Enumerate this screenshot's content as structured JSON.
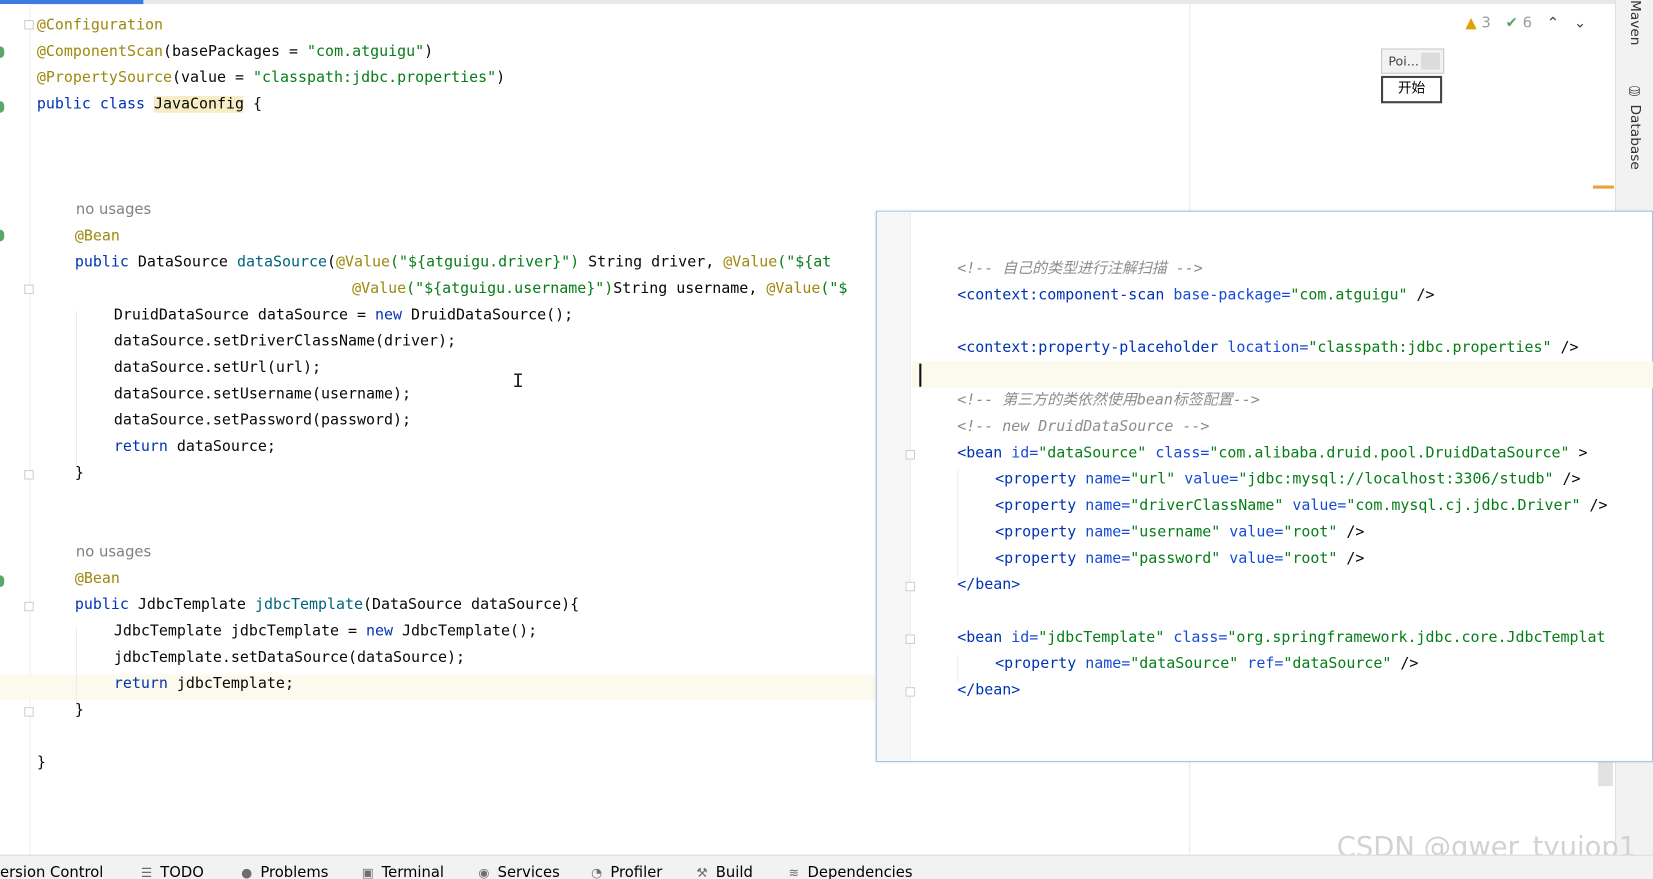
{
  "editor": {
    "no_usages_1": "no usages",
    "no_usages_2": "no usages",
    "code": {
      "l1": "@Configuration",
      "l2_ann": "@ComponentScan",
      "l2_rest": "(basePackages = ",
      "l2_str": "\"com.atguigu\"",
      "l2_end": ")",
      "l3_ann": "@PropertySource",
      "l3_rest": "(value = ",
      "l3_str": "\"classpath:jdbc.properties\"",
      "l3_end": ")",
      "l4_kw": "public class ",
      "l4_cls": "JavaConfig",
      "l4_end": " {",
      "bean": "@Bean",
      "ds_kw": "public ",
      "ds_type": "DataSource ",
      "ds_fn": "dataSource",
      "ds_p1": "(",
      "ds_a1": "@Value",
      "ds_s1": "(\"${atguigu.driver}\")",
      "ds_t1": " String driver, ",
      "ds_a2": "@Value",
      "ds_s2": "(\"${at",
      "ds2_a": "@Value",
      "ds2_s": "(\"${atguigu.username}\")",
      "ds2_t": "String username, ",
      "ds2_a2": "@Value",
      "ds2_s2": "(\"$",
      "b1": "DruidDataSource dataSource = ",
      "b1_new": "new",
      "b1_end": " DruidDataSource();",
      "b2": "dataSource.setDriverClassName(driver);",
      "b3": "dataSource.setUrl(url);",
      "b4": "dataSource.setUsername(username);",
      "b5": "dataSource.setPassword(password);",
      "b6_kw": "return",
      "b6_end": " dataSource;",
      "close1": "}",
      "jt_kw": "public ",
      "jt_type": "JdbcTemplate ",
      "jt_fn": "jdbcTemplate",
      "jt_end": "(DataSource dataSource){",
      "c1": "JdbcTemplate jdbcTemplate = ",
      "c1_new": "new",
      "c1_end": " JdbcTemplate();",
      "c2": "jdbcTemplate.setDataSource(dataSource);",
      "c3_kw": "return",
      "c3_end": " jdbcTemplate;",
      "close2": "}",
      "close3": "}"
    }
  },
  "inspections": {
    "warnings": "3",
    "weak_warnings": "6",
    "up": "⌃",
    "down": "⌄"
  },
  "overlay": {
    "mini_label": "Poi...",
    "start_button": "开始"
  },
  "right_toolbar": {
    "maven": "Maven",
    "database": "Database"
  },
  "popup": {
    "x1": "<!-- 自己的类型进行注解扫描 -->",
    "x2_open": "<context:",
    "x2_tag": "component-scan ",
    "x2_attr": "base-package=",
    "x2_val": "\"com.atguigu\"",
    "x2_end": " />",
    "x3_open": "<context:",
    "x3_tag": "property-placeholder ",
    "x3_attr": "location=",
    "x3_val": "\"classpath:jdbc.properties\"",
    "x3_end": " />",
    "x4": "<!-- 第三方的类依然使用bean标签配置-->",
    "x5": "<!-- new DruidDataSource -->",
    "x6_open": "<bean ",
    "x6_a1": "id=",
    "x6_v1": "\"dataSource\"",
    "x6_a2": " class=",
    "x6_v2": "\"com.alibaba.druid.pool.DruidDataSource\"",
    "x6_end": " >",
    "p1_open": "<property ",
    "p1_a1": "name=",
    "p1_v1": "\"url\"",
    "p1_a2": " value=",
    "p1_v2": "\"jdbc:mysql://localhost:3306/studb\"",
    "p1_end": " />",
    "p2_open": "<property ",
    "p2_a1": "name=",
    "p2_v1": "\"driverClassName\"",
    "p2_a2": " value=",
    "p2_v2": "\"com.mysql.cj.jdbc.Driver\"",
    "p2_end": " />",
    "p3_open": "<property ",
    "p3_a1": "name=",
    "p3_v1": "\"username\"",
    "p3_a2": " value=",
    "p3_v2": "\"root\"",
    "p3_end": " />",
    "p4_open": "<property ",
    "p4_a1": "name=",
    "p4_v1": "\"password\"",
    "p4_a2": " value=",
    "p4_v2": "\"root\"",
    "p4_end": " />",
    "x7": "</bean>",
    "x8_open": "<bean ",
    "x8_a1": "id=",
    "x8_v1": "\"jdbcTemplate\"",
    "x8_a2": " class=",
    "x8_v2": "\"org.springframework.jdbc.core.JdbcTemplat",
    "p5_open": "<property ",
    "p5_a1": "name=",
    "p5_v1": "\"dataSource\"",
    "p5_a2": " ref=",
    "p5_v2": "\"dataSource\"",
    "p5_end": " />",
    "x9": "</bean>"
  },
  "statusbar": {
    "version_control": "ersion Control",
    "todo": "TODO",
    "problems": "Problems",
    "terminal": "Terminal",
    "services": "Services",
    "profiler": "Profiler",
    "build": "Build",
    "dependencies": "Dependencies"
  },
  "watermark": "CSDN @qwer_tyuiop1"
}
